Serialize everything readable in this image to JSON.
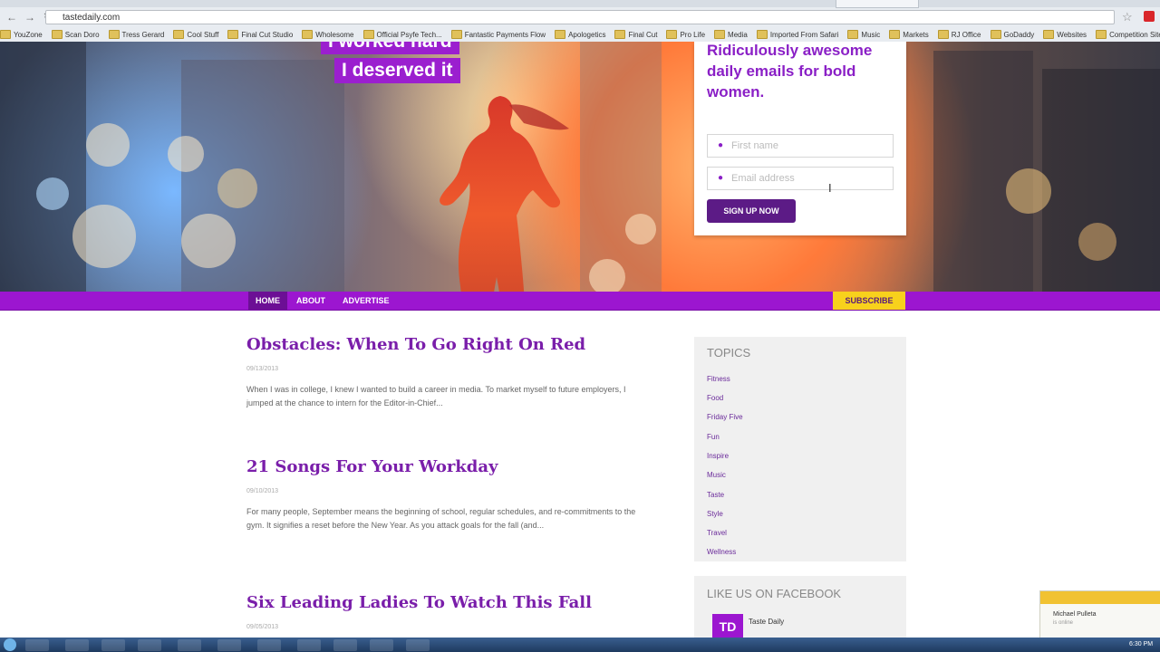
{
  "browser": {
    "url": "tastedaily.com",
    "bookmarks": [
      "YouZone",
      "Scan Doro",
      "Tress Gerard",
      "Cool Stuff",
      "Final Cut Studio",
      "Wholesome",
      "Official Psyfe Tech...",
      "Fantastic Payments Flow",
      "Apologetics",
      "Final Cut",
      "Pro Life",
      "Media",
      "Imported From Safari",
      "Music",
      "Markets",
      "RJ Office",
      "GoDaddy",
      "Websites",
      "Competition Sites"
    ]
  },
  "hero": {
    "tag_top": "I worked hard",
    "tag_bottom": "I deserved it",
    "signup_headline": "Ridiculously awesome daily emails for bold women.",
    "first_name_placeholder": "First name",
    "email_placeholder": "Email address",
    "signup_button": "SIGN UP NOW"
  },
  "nav": {
    "items": [
      "HOME",
      "ABOUT",
      "ADVERTISE"
    ],
    "subscribe": "SUBSCRIBE"
  },
  "articles": [
    {
      "title": "Obstacles: When To Go Right On Red",
      "date": "09/13/2013",
      "excerpt": "When I was in college, I knew I wanted to build a career in media. To market myself to future employers, I jumped at the chance to intern for the Editor-in-Chief..."
    },
    {
      "title": "21 Songs For Your Workday",
      "date": "09/10/2013",
      "excerpt": "For many people, September means the beginning of school, regular schedules, and re-commitments to the gym. It signifies a reset before the New Year. As you attack goals for the fall (and..."
    },
    {
      "title": "Six Leading Ladies To Watch This Fall",
      "date": "09/05/2013",
      "excerpt": ""
    }
  ],
  "sidebar": {
    "topics_heading": "TOPICS",
    "topics": [
      "Fitness",
      "Food",
      "Friday Five",
      "Fun",
      "Inspire",
      "Music",
      "Taste",
      "Style",
      "Travel",
      "Wellness"
    ],
    "facebook_heading": "LIKE US ON FACEBOOK",
    "facebook_page": "Taste Daily",
    "facebook_logo": "TD"
  },
  "chat": {
    "name": "Michael Pulleta",
    "status": "is online"
  },
  "taskbar": {
    "clock": "6:30 PM"
  },
  "colors": {
    "brand_purple": "#9c16d0",
    "subscribe_yellow": "#f8d11c",
    "title_purple": "#7a1eaa"
  }
}
